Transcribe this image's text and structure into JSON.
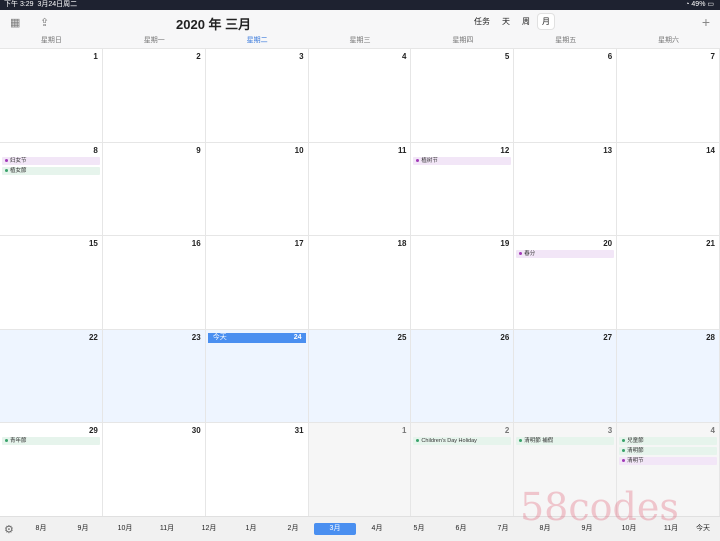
{
  "status_bar": {
    "time": "下午 3:29",
    "date": "3月24日周二",
    "battery": "49%"
  },
  "toolbar": {
    "title": "2020 年 三月",
    "views": [
      "任务",
      "天",
      "周",
      "月"
    ],
    "active_view": "月"
  },
  "weekdays": [
    "星期日",
    "星期一",
    "星期二",
    "星期三",
    "星期四",
    "星期五",
    "星期六"
  ],
  "weeks": [
    [
      {
        "day": "1"
      },
      {
        "day": "2"
      },
      {
        "day": "3"
      },
      {
        "day": "4"
      },
      {
        "day": "5"
      },
      {
        "day": "6"
      },
      {
        "day": "7"
      }
    ],
    [
      {
        "day": "8",
        "events": [
          {
            "label": "妇女节",
            "color": "#a23ab8",
            "bg": "#f2e6f7"
          },
          {
            "label": "植女節",
            "color": "#3aa36b",
            "bg": "#e6f4ec"
          }
        ]
      },
      {
        "day": "9"
      },
      {
        "day": "10"
      },
      {
        "day": "11"
      },
      {
        "day": "12",
        "events": [
          {
            "label": "植树节",
            "color": "#a23ab8",
            "bg": "#f2e6f7"
          }
        ]
      },
      {
        "day": "13"
      },
      {
        "day": "14"
      }
    ],
    [
      {
        "day": "15"
      },
      {
        "day": "16"
      },
      {
        "day": "17"
      },
      {
        "day": "18"
      },
      {
        "day": "19"
      },
      {
        "day": "20",
        "events": [
          {
            "label": "春分",
            "color": "#a23ab8",
            "bg": "#f2e6f7"
          }
        ]
      },
      {
        "day": "21"
      }
    ],
    [
      {
        "day": "22"
      },
      {
        "day": "23"
      },
      {
        "day": "24",
        "today": "今天"
      },
      {
        "day": "25"
      },
      {
        "day": "26"
      },
      {
        "day": "27"
      },
      {
        "day": "28"
      }
    ],
    [
      {
        "day": "29",
        "events": [
          {
            "label": "青年節",
            "color": "#3aa36b",
            "bg": "#e6f4ec"
          }
        ]
      },
      {
        "day": "30"
      },
      {
        "day": "31"
      },
      {
        "day": "1",
        "other": true
      },
      {
        "day": "2",
        "other": true,
        "events": [
          {
            "label": "Children's Day Holiday",
            "color": "#3aa36b",
            "bg": "#e6f4ec"
          }
        ]
      },
      {
        "day": "3",
        "other": true,
        "events": [
          {
            "label": "清明節 補假",
            "color": "#3aa36b",
            "bg": "#e6f4ec"
          }
        ]
      },
      {
        "day": "4",
        "other": true,
        "events": [
          {
            "label": "兒童節",
            "color": "#3aa36b",
            "bg": "#e6f4ec"
          },
          {
            "label": "清明節",
            "color": "#3aa36b",
            "bg": "#e6f4ec"
          },
          {
            "label": "清明节",
            "color": "#a23ab8",
            "bg": "#f2e6f7"
          }
        ]
      }
    ]
  ],
  "bottom": {
    "months": [
      "8月",
      "9月",
      "10月",
      "11月",
      "12月",
      "1月",
      "2月",
      "3月",
      "4月",
      "5月",
      "6月",
      "7月",
      "8月",
      "9月",
      "10月",
      "11月"
    ],
    "active_month": "3月",
    "today_label": "今天"
  },
  "watermark": "58codes",
  "colors": {
    "accent": "#4a8ff0"
  }
}
